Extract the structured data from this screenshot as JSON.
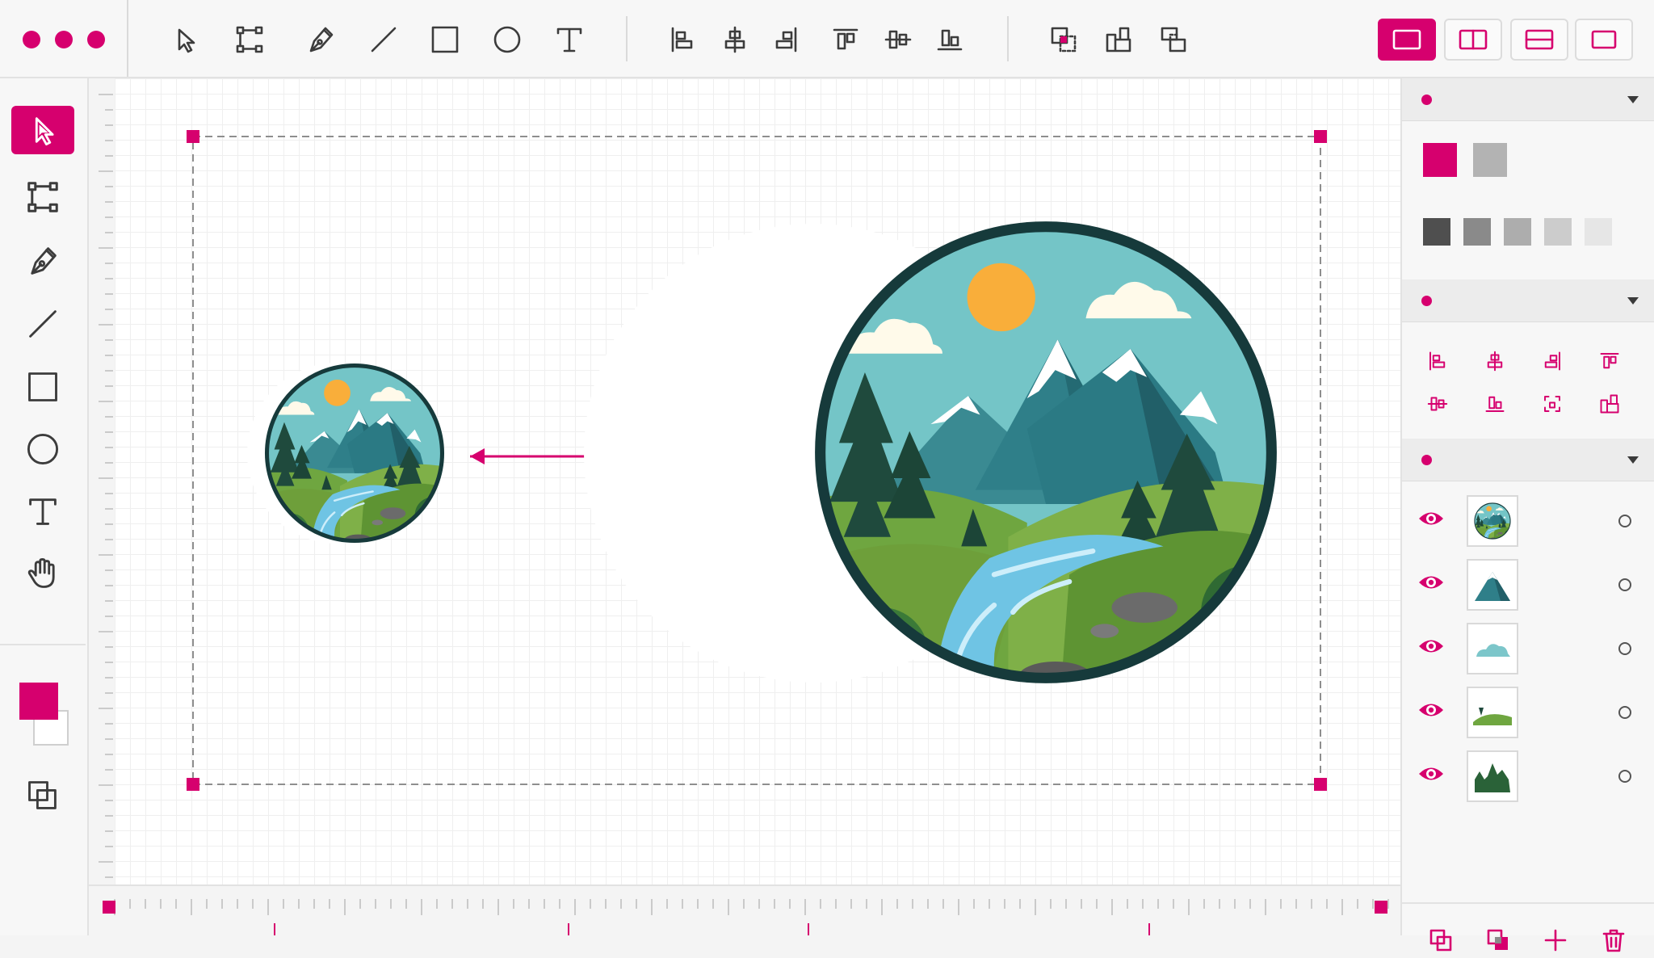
{
  "app": {
    "accent_color": "#d6006e"
  },
  "window_controls": [
    "window-dot",
    "window-dot",
    "window-dot"
  ],
  "top_toolbar": {
    "draw_tools": [
      "select-arrow-icon",
      "node-edit-icon",
      "pen-icon",
      "line-icon",
      "rectangle-icon",
      "ellipse-icon",
      "text-icon"
    ],
    "align_tools": [
      "align-left-icon",
      "align-center-horizontal-icon",
      "align-right-icon",
      "align-top-icon",
      "align-middle-vertical-icon",
      "align-bottom-icon"
    ],
    "boolean_tools": [
      "union-icon",
      "subtract-icon",
      "intersect-icon"
    ],
    "view_modes": [
      "single-view-icon",
      "split-vertical-view-icon",
      "split-horizontal-view-icon",
      "full-view-icon"
    ],
    "active_view": 0
  },
  "left_toolbar": {
    "tools": [
      "select-arrow-icon",
      "node-edit-icon",
      "pen-icon",
      "line-icon",
      "rectangle-icon",
      "ellipse-icon",
      "text-icon",
      "hand-icon"
    ],
    "active_tool": 0,
    "fill_color": "#d6006e",
    "stroke_color": "#ffffff"
  },
  "canvas": {
    "artboard": {
      "selected": true
    },
    "objects": [
      {
        "name": "landscape-badge-small",
        "scale": 1
      },
      {
        "name": "landscape-badge-large",
        "scale": 2.5
      }
    ],
    "resize_arrow": {
      "color": "#d6006e"
    }
  },
  "right_panel": {
    "color_section": {
      "primary_swatches": [
        "#d6006e",
        "#b3b3b3"
      ],
      "gray_swatches": [
        "#4f4f4f",
        "#8a8a8a",
        "#adadad",
        "#cccccc",
        "#e6e6e6"
      ]
    },
    "align_section": {
      "icons": [
        "align-left-icon",
        "align-center-horizontal-icon",
        "align-right-icon",
        "align-top-icon",
        "align-middle-vertical-icon",
        "align-bottom-icon",
        "distribute-icon",
        "subtract-icon"
      ]
    },
    "layers_section": {
      "layers": [
        {
          "thumbnail": "badge-layer-icon",
          "visible": true
        },
        {
          "thumbnail": "mountain-layer-icon",
          "visible": true
        },
        {
          "thumbnail": "cloud-layer-icon",
          "visible": true
        },
        {
          "thumbnail": "hill-layer-icon",
          "visible": true
        },
        {
          "thumbnail": "trees-layer-icon",
          "visible": true
        }
      ],
      "footer_actions": [
        "duplicate-layer-icon",
        "group-layers-icon",
        "add-layer-icon",
        "delete-layer-icon"
      ]
    }
  }
}
